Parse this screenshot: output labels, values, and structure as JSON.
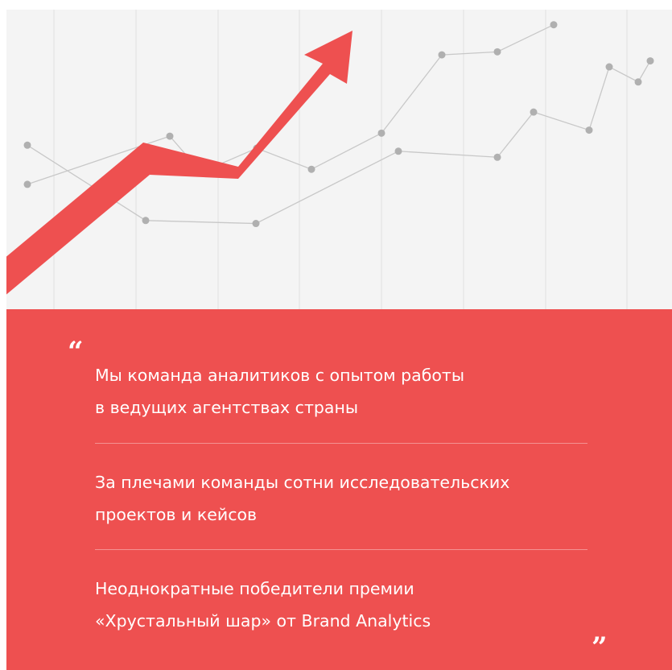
{
  "chart_data": {
    "type": "line",
    "title": "",
    "xlabel": "",
    "ylabel": "",
    "grid": true,
    "series": [
      {
        "values": [
          0.55,
          0.3,
          0.29,
          0.53,
          0.51,
          0.66,
          0.6,
          0.81,
          0.76,
          0.83
        ]
      },
      {
        "values": [
          0.42,
          0.58,
          0.46,
          0.54,
          0.47,
          0.59,
          0.85,
          0.86,
          0.95
        ]
      }
    ],
    "trend_arrow": {
      "color": "#ee5050",
      "direction": "up"
    }
  },
  "panel": {
    "bg": "#ee5050",
    "quote_open": "“",
    "quote_close": "”",
    "facts": [
      {
        "line1": "Мы команда аналитиков с опытом работы",
        "line2": "в ведущих агентствах страны"
      },
      {
        "line1": "За плечами команды сотни исследовательских",
        "line2": "проектов и кейсов"
      },
      {
        "line1": "Неоднократные победители премии",
        "line2": "«Хрустальный шар» от Brand Analytics"
      }
    ]
  }
}
